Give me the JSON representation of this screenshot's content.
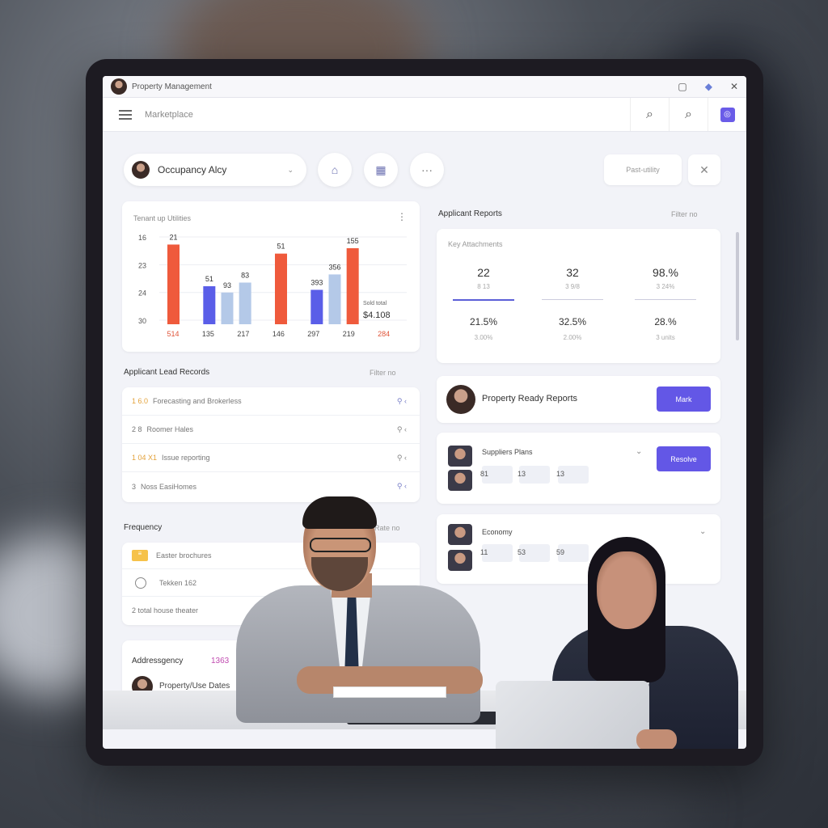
{
  "window": {
    "title": "Property Management",
    "app_label": "Marketplace"
  },
  "profile": {
    "name": "Occupancy Alcy"
  },
  "header_actions": {
    "filter_label": "Past-utility"
  },
  "chart_card": {
    "title": "Tenant up Utilities",
    "chart_data": {
      "type": "bar",
      "categories": [
        "514",
        "135",
        "217",
        "146",
        "297",
        "219",
        "284"
      ],
      "y_ticks": [
        "16",
        "23",
        "24",
        "30"
      ],
      "value_labels": [
        "21",
        "51",
        "93",
        "83",
        "51",
        "393",
        "356",
        "155"
      ],
      "annotation": [
        "Sold total",
        "$4.108"
      ],
      "series_colors": [
        "#ef5a3c",
        "#5a5ee8",
        "#b4c9e8"
      ],
      "bars": [
        {
          "x": 0,
          "value": 88,
          "color": "#ef5a3c",
          "label": "21"
        },
        {
          "x": 1,
          "value": 42,
          "color": "#5a5ee8",
          "label": "51"
        },
        {
          "x": 1.5,
          "value": 35,
          "color": "#b4c9e8",
          "label": "93"
        },
        {
          "x": 2,
          "value": 46,
          "color": "#b4c9e8",
          "label": "83"
        },
        {
          "x": 3,
          "value": 78,
          "color": "#ef5a3c",
          "label": "51"
        },
        {
          "x": 4,
          "value": 38,
          "color": "#5a5ee8",
          "label": "393"
        },
        {
          "x": 4.5,
          "value": 55,
          "color": "#b4c9e8",
          "label": "356"
        },
        {
          "x": 5,
          "value": 84,
          "color": "#ef5a3c",
          "label": "155"
        }
      ],
      "ylim": [
        0,
        100
      ]
    }
  },
  "applicant_reports": {
    "title": "Applicant Reports",
    "filter": "Filter no",
    "subtitle": "Key Attachments",
    "stats_top": [
      {
        "value": "22",
        "sub": "8 13"
      },
      {
        "value": "32",
        "sub": "3 9/8"
      },
      {
        "value": "98.%",
        "sub": "3 24%"
      }
    ],
    "stats_bottom": [
      {
        "value": "21.5%",
        "sub": "3.00%"
      },
      {
        "value": "32.5%",
        "sub": "2.00%"
      },
      {
        "value": "28.%",
        "sub": "3 units"
      }
    ]
  },
  "list_card": {
    "title": "Applicant Lead Records",
    "filter": "Filter no",
    "rows": [
      {
        "num": "1 6.0",
        "text": "Forecasting and Brokerless"
      },
      {
        "num": "2 8",
        "text": "Roomer Hales"
      },
      {
        "num": "1 04 X1",
        "text": "Issue reporting"
      },
      {
        "num": "3",
        "text": "Noss EasiHomes"
      }
    ]
  },
  "property_report": {
    "title": "Property Ready Reports",
    "button": "Mark"
  },
  "suppliers": {
    "title": "Suppliers Plans",
    "button": "Resolve",
    "chips": [
      "81",
      "13",
      "13"
    ]
  },
  "economy": {
    "title": "Economy",
    "chips": [
      "11",
      "53",
      "59"
    ]
  },
  "frequency": {
    "title": "Frequency",
    "filter": "Rate no",
    "rows": [
      "Easter brochures",
      "Tekken 162",
      "2 total house theater"
    ]
  },
  "agreement": {
    "title": "Addressgency",
    "count": "1363",
    "row": "Property/Use Dates"
  }
}
